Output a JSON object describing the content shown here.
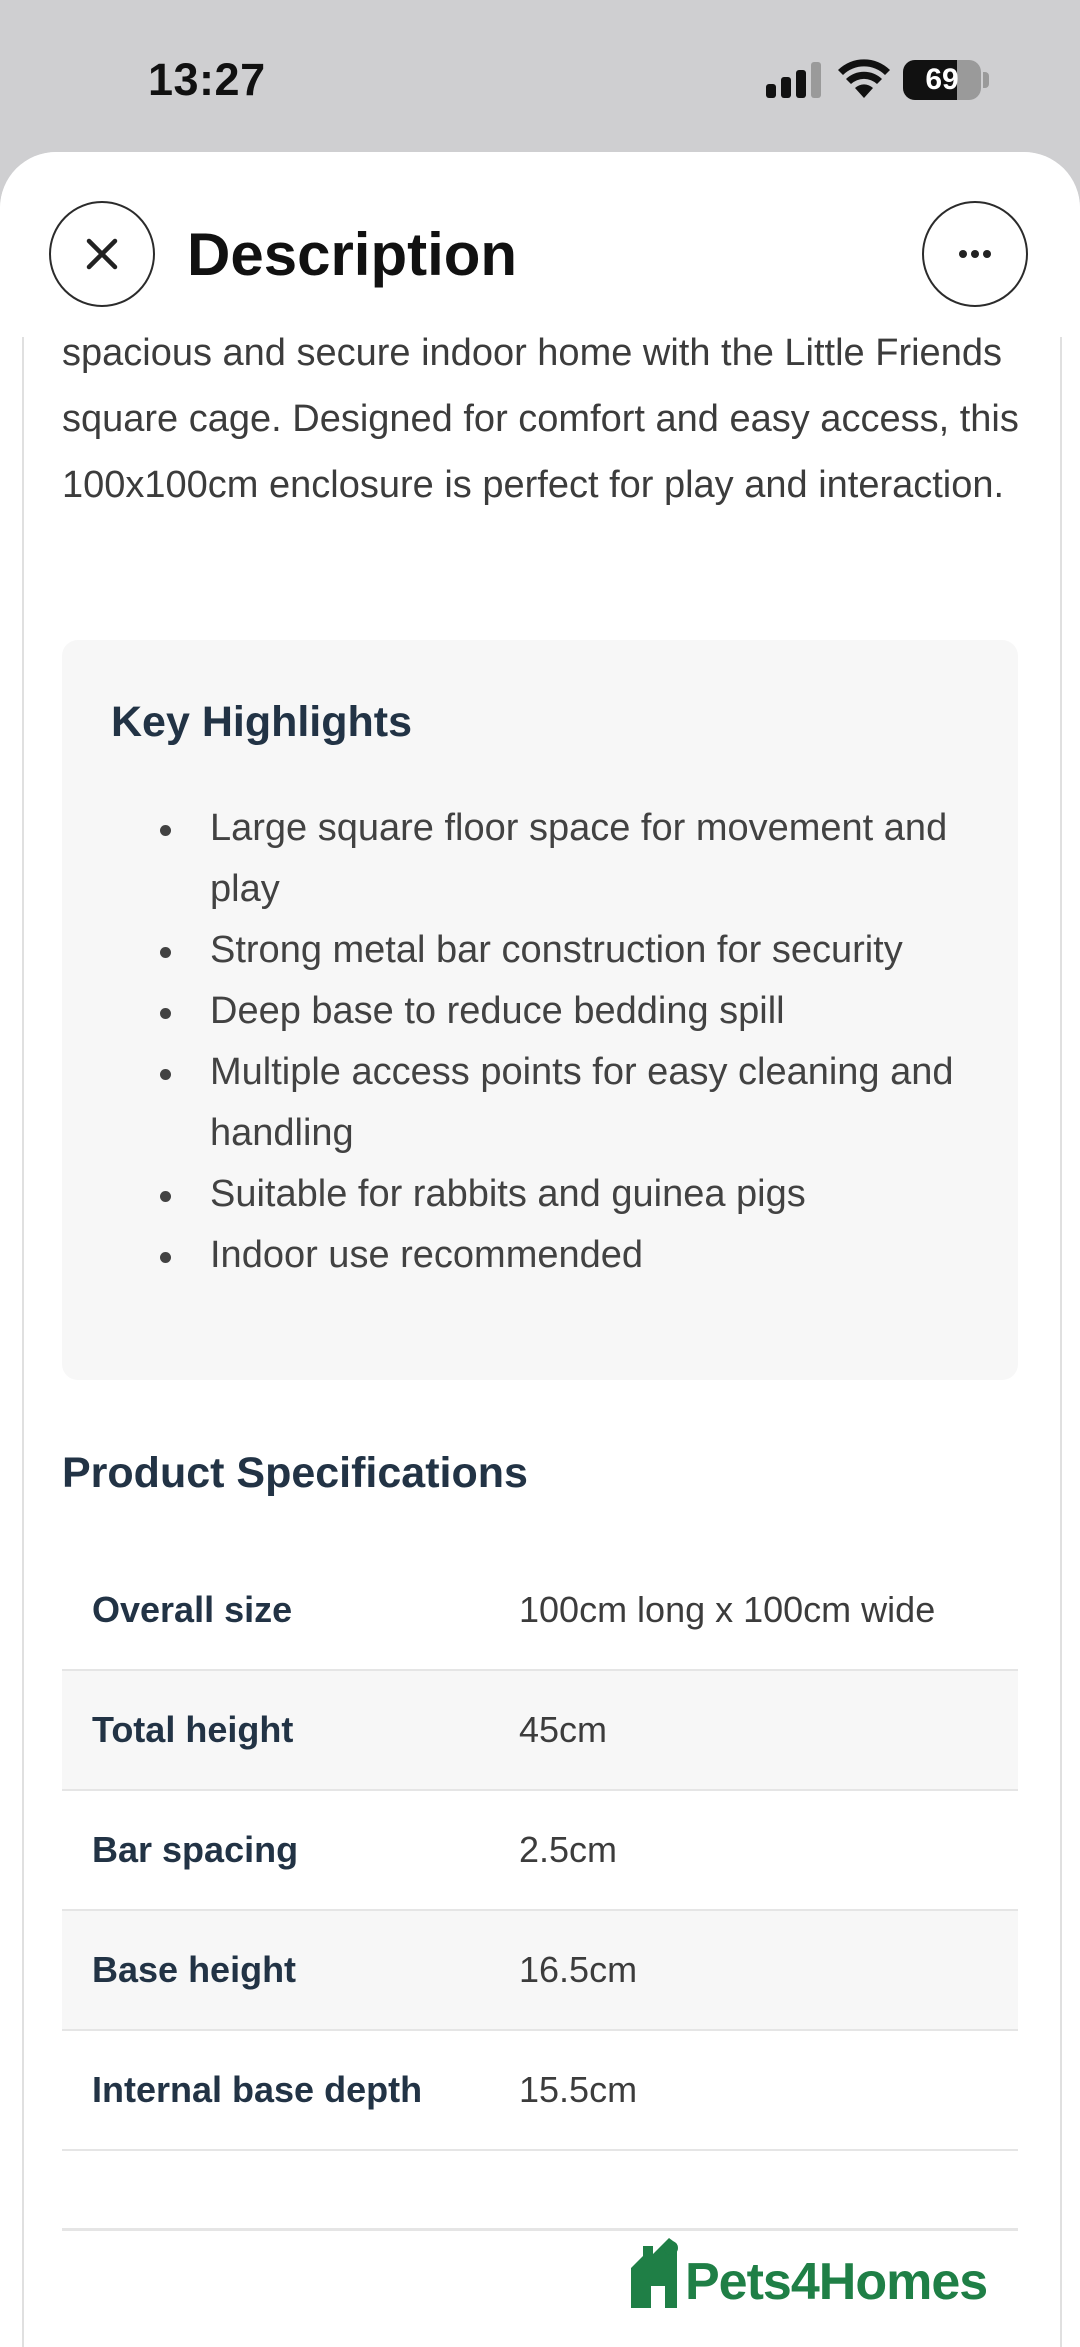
{
  "status_bar": {
    "time": "13:27",
    "battery": "69",
    "battery_level": 0.69
  },
  "header": {
    "title": "Description",
    "close_icon": "close-icon",
    "more_icon": "ellipsis-icon"
  },
  "intro": "spacious and secure indoor home with the Little Friends square cage. Designed for comfort and easy access, this 100x100cm enclosure is perfect for play and interaction.",
  "highlights": {
    "title": "Key Highlights",
    "items": [
      "Large square floor space for movement and play",
      "Strong metal bar construction for security",
      "Deep base to reduce bedding spill",
      "Multiple access points for easy cleaning and handling",
      "Suitable for rabbits and guinea pigs",
      "Indoor use recommended"
    ]
  },
  "specifications": {
    "title": "Product Specifications",
    "rows": [
      {
        "label": "Overall size",
        "value": "100cm long x 100cm wide"
      },
      {
        "label": "Total height",
        "value": "45cm"
      },
      {
        "label": "Bar spacing",
        "value": "2.5cm"
      },
      {
        "label": "Base height",
        "value": "16.5cm"
      },
      {
        "label": "Internal base depth",
        "value": "15.5cm"
      }
    ]
  },
  "watermark": {
    "brand": "Pets4Homes",
    "color": "#1f7f46"
  }
}
